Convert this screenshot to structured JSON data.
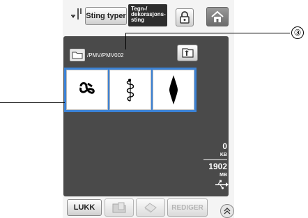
{
  "header": {
    "stitch_types_label": "Sting typer",
    "char_decor_label_lines": [
      "Tegn-/",
      "dekorasjons-",
      "sting"
    ]
  },
  "path": "/PMV/PMV002",
  "callout": {
    "number": "③"
  },
  "memory": {
    "used_value": "0",
    "used_unit": "KB",
    "total_value": "1902",
    "total_unit": "MB"
  },
  "footer": {
    "close_label": "LUKK",
    "edit_label": "REDIGER"
  },
  "colors": {
    "panel_bg": "#4a4a4a",
    "selection_border": "#3b82d6",
    "frame_bg": "#f4f4f4"
  },
  "icons": [
    "needle-mode-icon",
    "lock-icon",
    "home-icon",
    "folder-icon",
    "folder-up-icon",
    "usb-icon",
    "copy-icon",
    "delete-icon",
    "page-up-icon"
  ]
}
